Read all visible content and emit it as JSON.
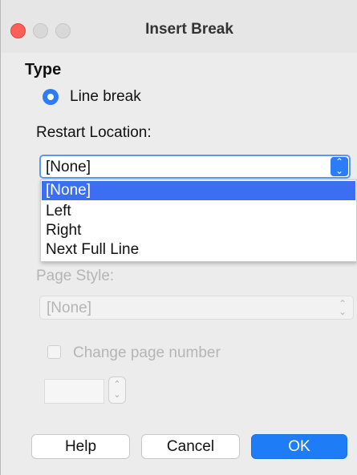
{
  "window": {
    "title": "Insert Break"
  },
  "type_section": {
    "heading": "Type",
    "selected_radio_label": "Line break"
  },
  "restart_location": {
    "label": "Restart Location:",
    "selected_value": "[None]",
    "options": [
      "[None]",
      "Left",
      "Right",
      "Next Full Line"
    ],
    "selected_index": 0
  },
  "page_style": {
    "label": "Page Style:",
    "value": "[None]",
    "enabled": false
  },
  "change_page_number": {
    "label": "Change page number",
    "checked": false,
    "enabled": false,
    "value": ""
  },
  "buttons": {
    "help": "Help",
    "cancel": "Cancel",
    "ok": "OK"
  },
  "colors": {
    "accent": "#2b7cf6",
    "selection": "#3b6ef3",
    "close_light": "#fe5f57",
    "disabled_text": "#b5b5b5"
  }
}
